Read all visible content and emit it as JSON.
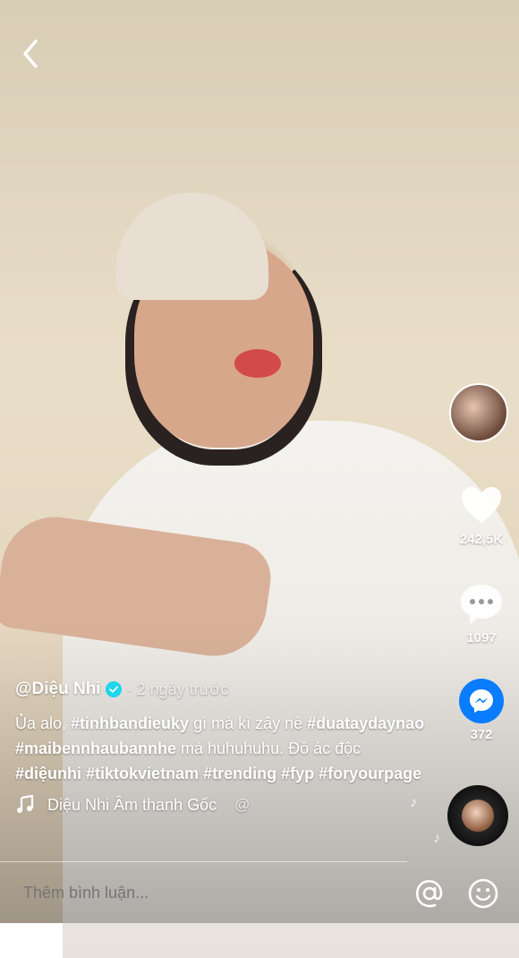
{
  "header": {
    "back_icon": "chevron-left-icon"
  },
  "rail": {
    "likes": "242,5K",
    "comments": "1097",
    "shares": "372"
  },
  "post": {
    "author": "@Diệu Nhi",
    "time": "· 2 ngày trước",
    "desc_parts": [
      {
        "text": "Ủa alo,  ",
        "tag": false
      },
      {
        "text": "#tinhbandieuky",
        "tag": true
      },
      {
        "text": " gì mà kì zậy nè ",
        "tag": false
      },
      {
        "text": "#duataydaynao",
        "tag": true
      },
      {
        "text": " ",
        "tag": false
      },
      {
        "text": "#maibennhaubannhe",
        "tag": true
      },
      {
        "text": " mà huhuhuhu. Đồ ác độc ",
        "tag": false
      },
      {
        "text": "#diệunhi",
        "tag": true
      },
      {
        "text": " ",
        "tag": false
      },
      {
        "text": "#tiktokvietnam",
        "tag": true
      },
      {
        "text": " ",
        "tag": false
      },
      {
        "text": "#trending",
        "tag": true
      },
      {
        "text": " ",
        "tag": false
      },
      {
        "text": "#fyp",
        "tag": true
      },
      {
        "text": " ",
        "tag": false
      },
      {
        "text": "#foryourpage",
        "tag": true
      }
    ],
    "sound": "Diệu Nhi Âm thanh Gốc",
    "sound_at": "@"
  },
  "comment_bar": {
    "placeholder": "Thêm bình luận..."
  },
  "colors": {
    "messenger": "#0a7cff",
    "verified": "#20d5ec"
  }
}
